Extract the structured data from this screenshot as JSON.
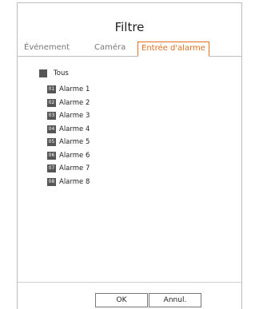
{
  "dialog": {
    "title": "Filtre"
  },
  "tabs": [
    {
      "label": "Événement",
      "active": false
    },
    {
      "label": "Caméra",
      "active": false
    },
    {
      "label": "Entrée d'alarme",
      "active": true
    }
  ],
  "select_all": {
    "label": "Tous",
    "checked": true
  },
  "alarms": [
    {
      "number": "01",
      "label": "Alarme 1",
      "checked": true
    },
    {
      "number": "02",
      "label": "Alarme 2",
      "checked": true
    },
    {
      "number": "03",
      "label": "Alarme 3",
      "checked": true
    },
    {
      "number": "04",
      "label": "Alarme 4",
      "checked": true
    },
    {
      "number": "05",
      "label": "Alarme 5",
      "checked": true
    },
    {
      "number": "06",
      "label": "Alarme 6",
      "checked": true
    },
    {
      "number": "07",
      "label": "Alarme 7",
      "checked": true
    },
    {
      "number": "08",
      "label": "Alarme 8",
      "checked": true
    }
  ],
  "buttons": {
    "ok_label": "OK",
    "cancel_label": "Annul."
  },
  "colors": {
    "accent": "#e07020",
    "checkbox": "#555555",
    "border": "#bdbdbd"
  }
}
